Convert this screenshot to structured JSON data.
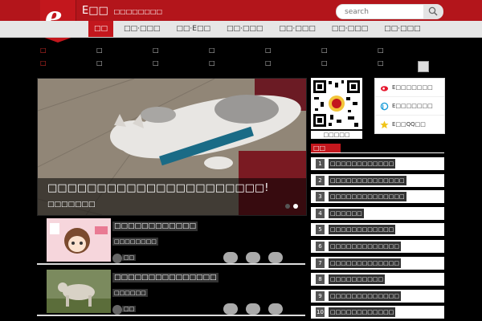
{
  "header": {
    "logo_letter": "e",
    "brand": "E□□",
    "slogan": "□□□□□□□□",
    "search_placeholder": "search"
  },
  "nav": {
    "items": [
      "□□",
      "□□·□□□",
      "□□·E□□",
      "□□·□□□",
      "□□·□□□",
      "□□·□□□",
      "□□·□□□"
    ],
    "active": 0
  },
  "channels": {
    "row1": [
      "□",
      "□",
      "□",
      "□",
      "□",
      "□",
      "□"
    ],
    "row2": [
      "□",
      "□",
      "□",
      "□",
      "□",
      "□",
      "□"
    ]
  },
  "slider": {
    "caption": "□□□□□□□□□□□□□□□□□□□□□□!",
    "subcaption": "□□□□□□□",
    "dots": 2
  },
  "sidebar": {
    "qr_label": "□□□□□",
    "social": [
      {
        "label": "E□□□□□□□",
        "icon": "weibo-icon",
        "color": "#e6162d"
      },
      {
        "label": "E□□□□□□□",
        "icon": "tencent-weibo-icon",
        "color": "#1d9ed9"
      },
      {
        "label": "E□□QQ□□",
        "icon": "qzone-star-icon",
        "color": "#f0c419"
      }
    ],
    "hot_title": "□□",
    "hot_items": [
      {
        "num": "1",
        "text": "□□□□□□□□□□□□"
      },
      {
        "num": "2",
        "text": "□□□□□□□□□□□□□□"
      },
      {
        "num": "3",
        "text": "□□□□□□□□□□□□□□"
      },
      {
        "num": "4",
        "text": "□□□□□□"
      },
      {
        "num": "5",
        "text": "□□□□□□□□□□□□"
      },
      {
        "num": "6",
        "text": "□□□□□□□□□□□□□"
      },
      {
        "num": "7",
        "text": "□□□□□□□□□□□□□"
      },
      {
        "num": "8",
        "text": "□□□□□□□□□□"
      },
      {
        "num": "9",
        "text": "□□□□□□□□□□□□□"
      },
      {
        "num": "10",
        "text": "□□□□□□□□□□□□"
      }
    ]
  },
  "news": [
    {
      "title": "□□□□□□□□□□□□",
      "category": "□□□□□□□□",
      "author": "□□"
    },
    {
      "title": "□□□□□□□□□□□□□□□",
      "category": "□□□□□□",
      "author": "□□"
    }
  ],
  "colors": {
    "brand_red": "#c3171d",
    "nav_bg": "#e6e6e6"
  }
}
